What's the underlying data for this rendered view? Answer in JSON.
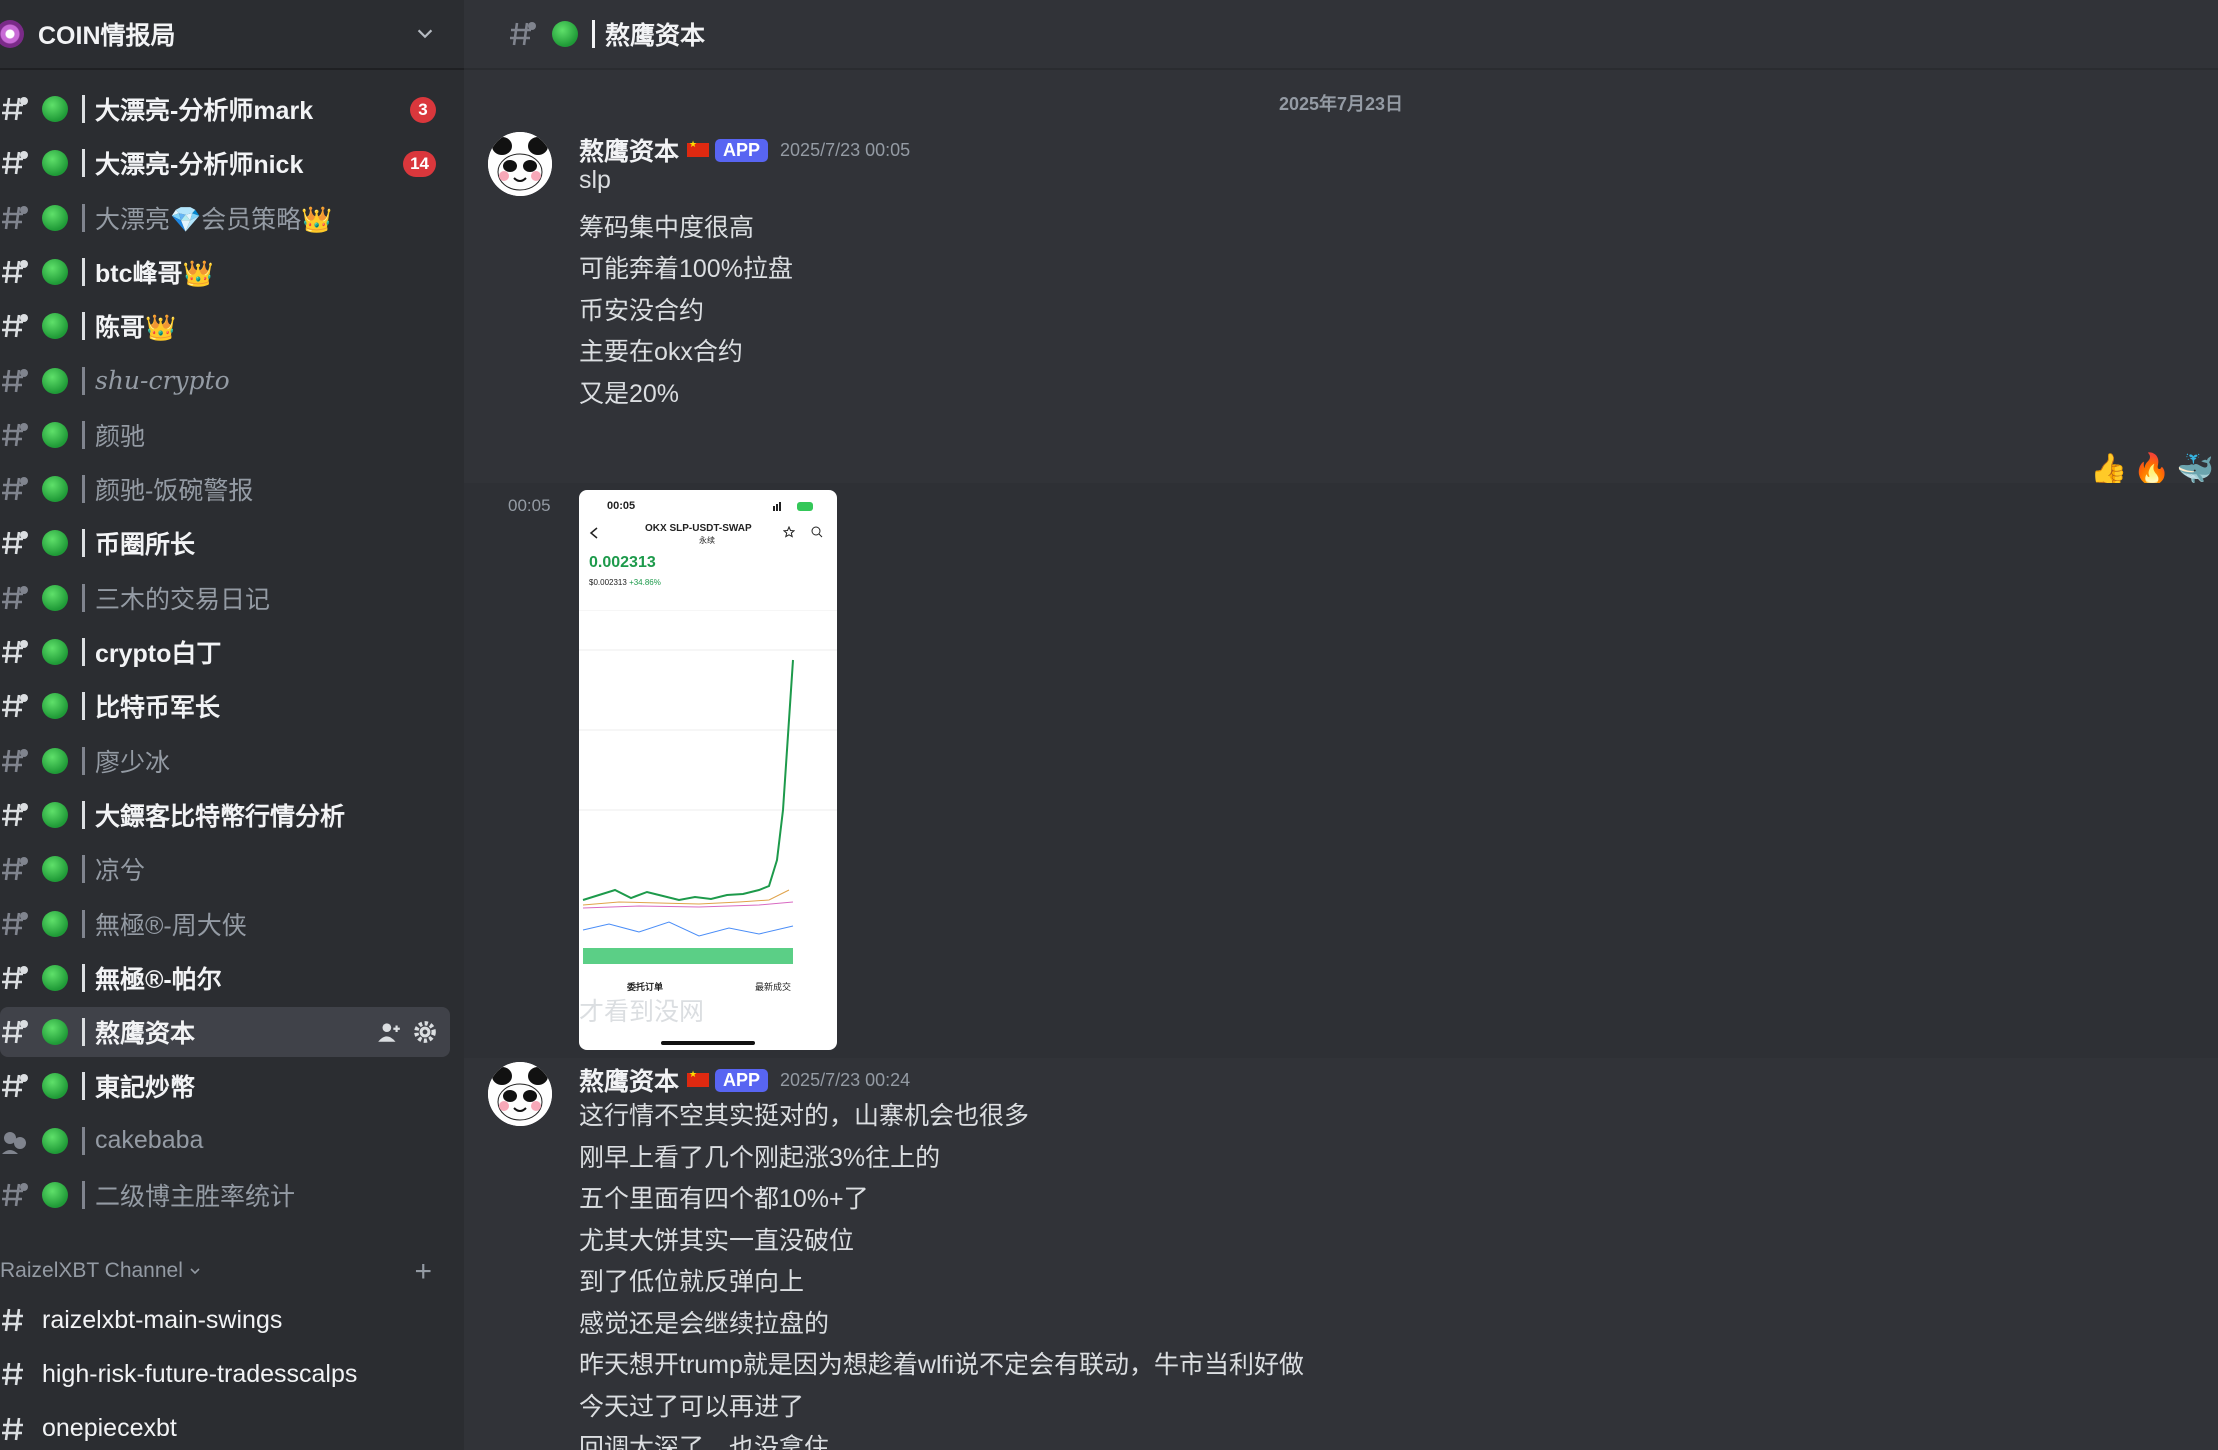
{
  "server": {
    "name": "COIN情报局"
  },
  "channels": [
    {
      "name": "大漂亮-分析师mark",
      "state": "unread",
      "badge": "3"
    },
    {
      "name": "大漂亮-分析师nick",
      "state": "unread",
      "badge": "14"
    },
    {
      "name": "大漂亮💎会员策略👑",
      "state": "muted"
    },
    {
      "name": "btc峰哥👑",
      "state": "unread"
    },
    {
      "name": "陈哥👑",
      "state": "unread"
    },
    {
      "name": "shu-crypto",
      "state": "muted"
    },
    {
      "name": "颜驰",
      "state": "muted"
    },
    {
      "name": "颜驰-饭碗警报",
      "state": "muted"
    },
    {
      "name": "币圈所长",
      "state": "unread"
    },
    {
      "name": "三木的交易日记",
      "state": "muted"
    },
    {
      "name": "crypto白丁",
      "state": "unread"
    },
    {
      "name": "比特币军长",
      "state": "unread"
    },
    {
      "name": "廖少冰",
      "state": "muted"
    },
    {
      "name": "大鏢客比特幣行情分析",
      "state": "unread"
    },
    {
      "name": "凉兮",
      "state": "muted"
    },
    {
      "name": "無極®-周大侠",
      "state": "muted"
    },
    {
      "name": "無極®-帕尔",
      "state": "unread"
    },
    {
      "name": "熬鹰资本",
      "state": "active"
    },
    {
      "name": "東記炒幣",
      "state": "unread"
    },
    {
      "name": "cakebaba",
      "state": "muted"
    },
    {
      "name": "二级博主胜率统计",
      "state": "muted"
    }
  ],
  "category": {
    "name": "RaizelXBT Channel"
  },
  "category_channels": [
    {
      "name": "raizelxbt-main-swings"
    },
    {
      "name": "high-risk-future-tradesscalps"
    },
    {
      "name": "onepiecexbt"
    }
  ],
  "header": {
    "channel_name": "熬鹰资本"
  },
  "date_divider": "2025年7月23日",
  "messages": [
    {
      "author": "熬鹰资本",
      "tag": "APP",
      "timestamp": "2025/7/23 00:05",
      "lines": [
        "slp",
        "筹码集中度很高",
        "可能奔着100%拉盘",
        "币安没合约",
        "主要在okx合约",
        "又是20%"
      ]
    },
    {
      "side_time": "00:05",
      "phone": {
        "status_time": "00:05",
        "pair": "OKX SLP-USDT-SWAP",
        "pair_sub": "永续",
        "price": "0.002313",
        "sub_price": "$0.002313",
        "change": "+34.86%",
        "tab_orders": "委托订单",
        "tab_trades": "最新成交"
      },
      "caption": "才看到没网"
    },
    {
      "author": "熬鹰资本",
      "tag": "APP",
      "timestamp": "2025/7/23 00:24",
      "lines": [
        "这行情不空其实挺对的，山寨机会也很多",
        "刚早上看了几个刚起涨3%往上的",
        "五个里面有四个都10%+了",
        "尤其大饼其实一直没破位",
        "到了低位就反弹向上",
        "感觉还是会继续拉盘的",
        "昨天想开trump就是因为想趁着wlfi说不定会有联动，牛市当利好做",
        "今天过了可以再进了",
        "回调太深了，也没拿住"
      ]
    }
  ],
  "reactions": [
    "👍",
    "🔥",
    "🐳"
  ]
}
